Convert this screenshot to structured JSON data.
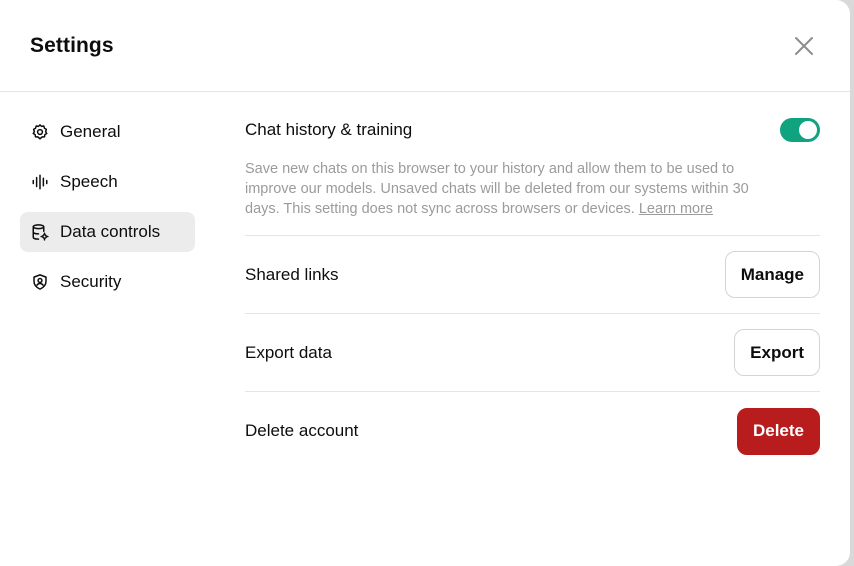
{
  "dialog": {
    "title": "Settings",
    "close_icon": "close-icon"
  },
  "sidebar": {
    "items": [
      {
        "label": "General",
        "icon": "gear-icon",
        "active": false
      },
      {
        "label": "Speech",
        "icon": "waveform-icon",
        "active": false
      },
      {
        "label": "Data controls",
        "icon": "database-gear-icon",
        "active": true
      },
      {
        "label": "Security",
        "icon": "shield-icon",
        "active": false
      }
    ]
  },
  "data_controls": {
    "chat_history": {
      "label": "Chat history & training",
      "enabled": true,
      "description": "Save new chats on this browser to your history and allow them to be used to improve our models. Unsaved chats will be deleted from our systems within 30 days. This setting does not sync across browsers or devices.",
      "learn_more": "Learn more"
    },
    "shared_links": {
      "label": "Shared links",
      "button": "Manage"
    },
    "export_data": {
      "label": "Export data",
      "button": "Export"
    },
    "delete_account": {
      "label": "Delete account",
      "button": "Delete"
    }
  },
  "colors": {
    "toggle_on": "#10a37f",
    "danger": "#b91c1c",
    "active_nav_bg": "#ececec"
  }
}
